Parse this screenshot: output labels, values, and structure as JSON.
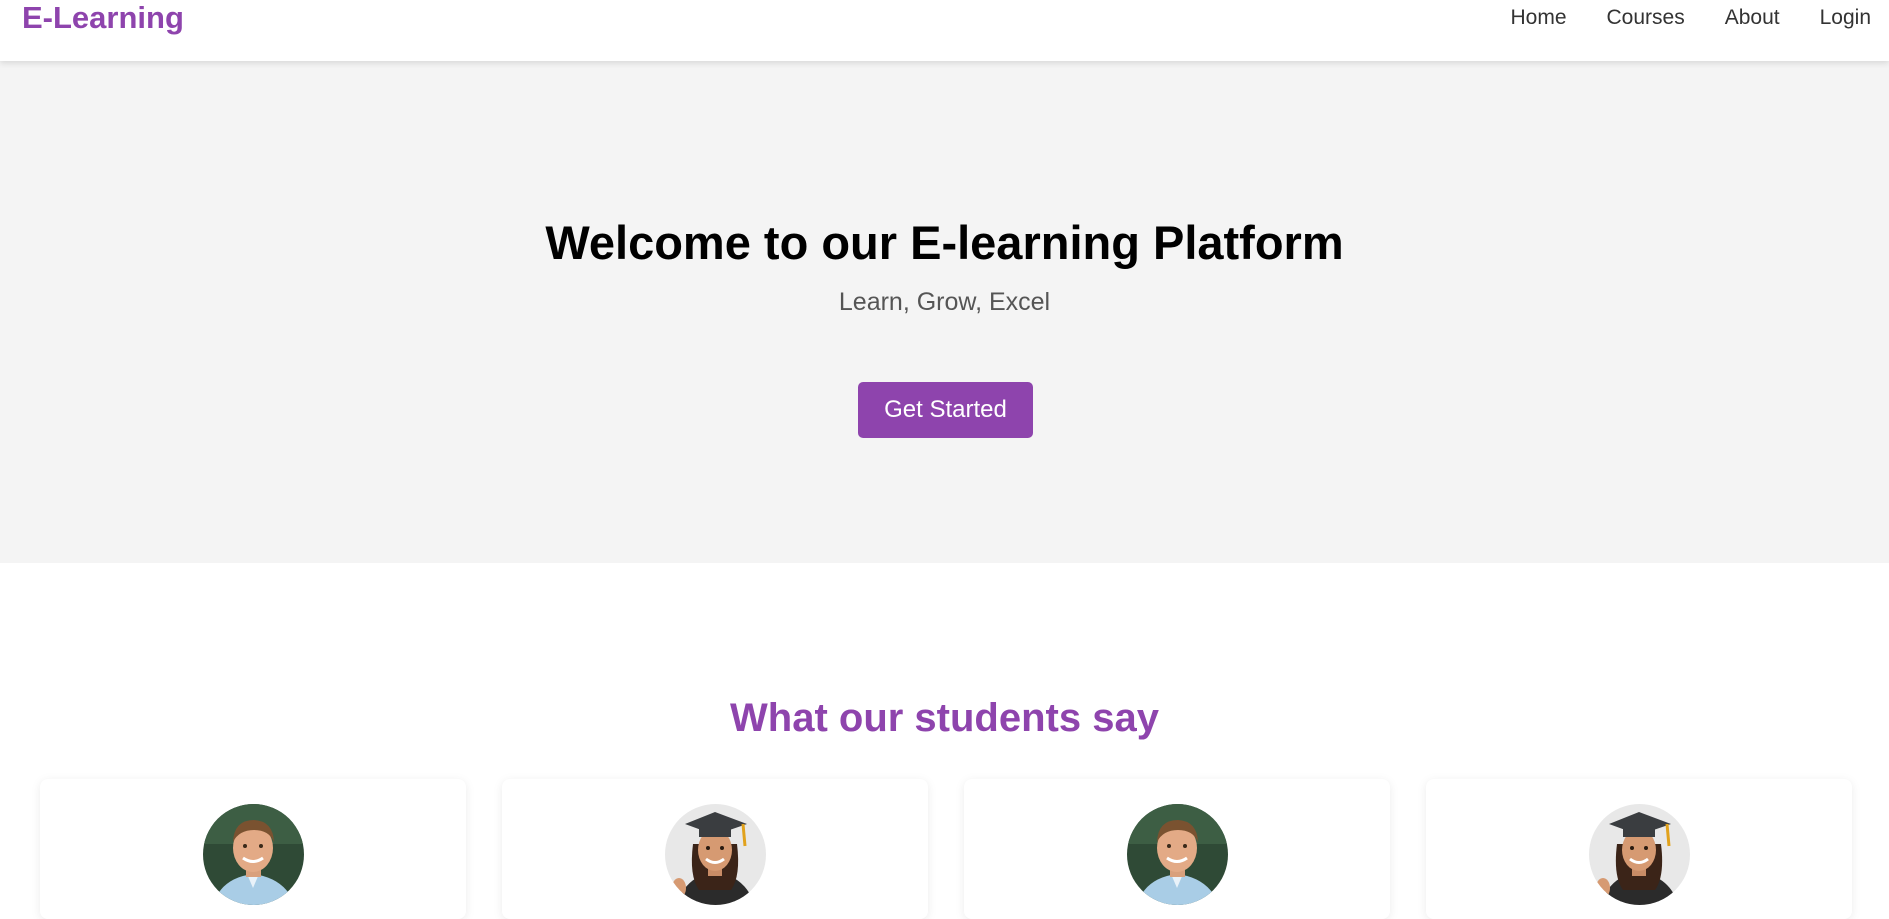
{
  "navbar": {
    "brand": "E-Learning",
    "links": [
      "Home",
      "Courses",
      "About",
      "Login"
    ]
  },
  "hero": {
    "title": "Welcome to our E-learning Platform",
    "subtitle": "Learn, Grow, Excel",
    "cta_label": "Get Started"
  },
  "testimonials": {
    "title": "What our students say",
    "cards": [
      {
        "avatar": "male-student-photo"
      },
      {
        "avatar": "female-graduate-photo"
      },
      {
        "avatar": "male-student-photo"
      },
      {
        "avatar": "female-graduate-photo"
      }
    ]
  },
  "colors": {
    "accent": "#8e44ad",
    "hero_background": "#f4f4f4",
    "text": "#333333"
  }
}
